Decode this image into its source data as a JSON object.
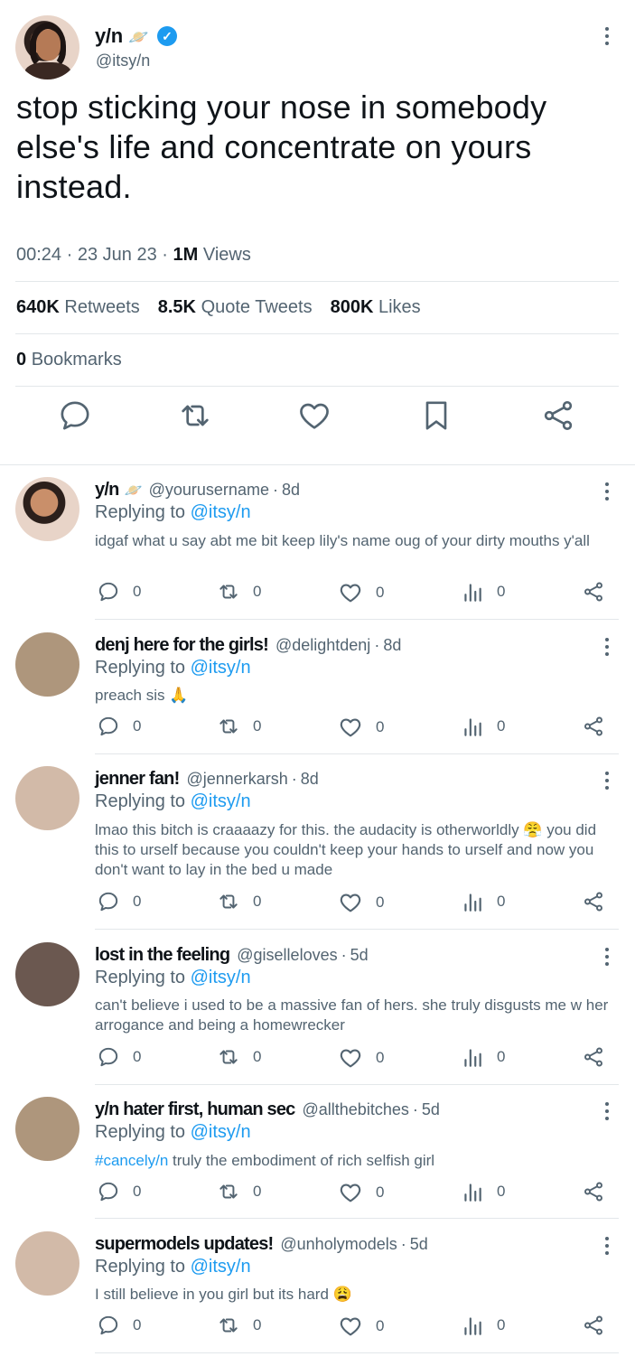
{
  "main_tweet": {
    "name": "y/n",
    "name_emoji": "🪐",
    "verified": true,
    "handle": "@itsy/n",
    "text": "stop sticking your nose in somebody else's life and concentrate on yours instead.",
    "time": "00:24",
    "date": "23 Jun 23",
    "views_count": "1M",
    "views_label": "Views",
    "retweets_count": "640K",
    "retweets_label": "Retweets",
    "quotes_count": "8.5K",
    "quotes_label": "Quote Tweets",
    "likes_count": "800K",
    "likes_label": "Likes",
    "bookmarks_count": "0",
    "bookmarks_label": "Bookmarks",
    "actions": [
      "reply-icon",
      "retweet-icon",
      "like-icon",
      "bookmark-icon",
      "share-icon"
    ]
  },
  "colors": {
    "link": "#1d9bf0",
    "secondary_text": "#536471",
    "primary_text": "#0f1419",
    "divider": "#e3e7ea"
  },
  "replies": [
    {
      "name": "y/n",
      "name_emoji": "🪐",
      "handle": "@yourusername",
      "age": "8d",
      "replying_prefix": "Replying to",
      "replying_to": "@itsy/n",
      "text": "idgaf what u say abt me bit keep lily's name oug of your dirty mouths y'all",
      "avatar_color": "photo",
      "replies": "0",
      "retweets": "0",
      "likes": "0",
      "views": "0"
    },
    {
      "name": "denj here for the girls!",
      "handle": "@delightdenj",
      "age": "8d",
      "replying_prefix": "Replying to",
      "replying_to": "@itsy/n",
      "text": "preach sis 🙏",
      "avatar_color": "#ae967c",
      "replies": "0",
      "retweets": "0",
      "likes": "0",
      "views": "0"
    },
    {
      "name": "jenner fan!",
      "handle": "@jennerkarsh",
      "age": "8d",
      "replying_prefix": "Replying to",
      "replying_to": "@itsy/n",
      "text": "lmao this bitch is craaaazy for this. the audacity is otherworldly 😤 you did this to urself because you couldn't keep your hands to urself and now you don't want to lay in the bed u made",
      "avatar_color": "#d2baa8",
      "replies": "0",
      "retweets": "0",
      "likes": "0",
      "views": "0"
    },
    {
      "name": "lost in the feeling",
      "handle": "@giselleloves",
      "age": "5d",
      "replying_prefix": "Replying to",
      "replying_to": "@itsy/n",
      "text": "can't believe i used to be a massive fan of hers. she truly disgusts me w her arrogance and being a homewrecker",
      "avatar_color": "#6b5850",
      "replies": "0",
      "retweets": "0",
      "likes": "0",
      "views": "0"
    },
    {
      "name": "y/n hater first, human sec",
      "handle": "@allthebitches",
      "age": "5d",
      "replying_prefix": "Replying to",
      "replying_to": "@itsy/n",
      "hashtag": "#cancely/n",
      "text": "truly the embodiment of rich selfish girl",
      "avatar_color": "#ae967c",
      "replies": "0",
      "retweets": "0",
      "likes": "0",
      "views": "0"
    },
    {
      "name": "supermodels updates!",
      "handle": "@unholymodels",
      "age": "5d",
      "replying_prefix": "Replying to",
      "replying_to": "@itsy/n",
      "text": "I still believe in you girl but its hard 😩",
      "avatar_color": "#d2baa8",
      "replies": "0",
      "retweets": "0",
      "likes": "0",
      "views": "0"
    }
  ]
}
